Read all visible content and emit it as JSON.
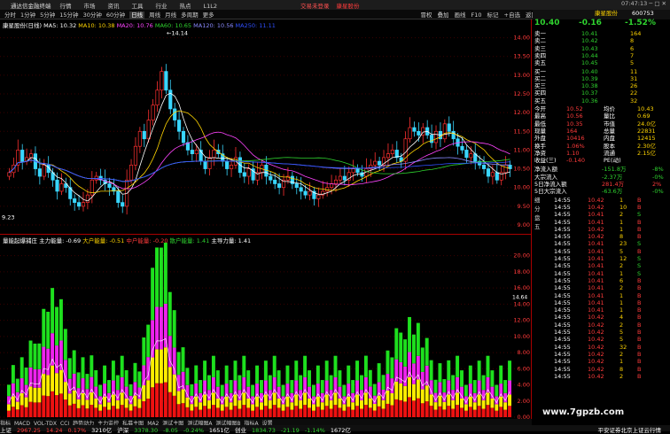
{
  "titlebar": {
    "app": "通达信金融终端",
    "menu": [
      "行情",
      "市场",
      "资讯",
      "工具",
      "行业",
      "热点",
      "L1L2"
    ],
    "notice1": "交易未登录",
    "notice2": "康星股份",
    "time": "07:47:13"
  },
  "toolbar": {
    "periods": [
      "分时",
      "1分钟",
      "5分钟",
      "15分钟",
      "30分钟",
      "60分钟",
      "日线",
      "周线",
      "月线",
      "多周期",
      "更多"
    ],
    "active_period": "日线",
    "right_tabs": [
      "冒权",
      "叠加",
      "画线",
      "F10",
      "标记",
      "+自选",
      "返回"
    ]
  },
  "kchart": {
    "legend": {
      "title": "康星股份(日线)",
      "ma5": "MA5: 10.32",
      "ma10": "MA10: 10.38",
      "ma20": "MA20: 10.76",
      "ma60": "MA60: 10.65",
      "ma120": "MA120: 10.56",
      "ma250": "MA250: 11.11"
    },
    "y_ticks": [
      "14.00",
      "13.50",
      "13.00",
      "12.50",
      "12.00",
      "11.50",
      "11.00",
      "10.50",
      "10.00",
      "9.50",
      "9.00"
    ],
    "high_label": "14.14",
    "low_label": "9.23",
    "ma_colors": {
      "ma5": "#ffffff",
      "ma10": "#ffd400",
      "ma20": "#ff44ff",
      "ma60": "#2fd32f",
      "ma120": "#8a8aff",
      "ma250": "#3050ff"
    }
  },
  "indicator": {
    "legend": {
      "title": "量能起爆捕庄",
      "main": "主力能量: -0.69",
      "big": "大户能量: -0.51",
      "mid": "中户能量: -0.20",
      "retail": "散户能量: 1.41",
      "force": "主导力量: 1.41"
    },
    "y_ticks": [
      "20.00",
      "18.00",
      "16.00",
      "14.00",
      "12.00",
      "10.00",
      "8.00",
      "6.00",
      "4.00",
      "2.00",
      "0.00"
    ],
    "side_label": "14.64",
    "series": [
      {
        "name": "散户能量",
        "color": "#1ee01e"
      },
      {
        "name": "中户能量",
        "color": "#ee22ee"
      },
      {
        "name": "大户能量",
        "color": "#ffee00"
      },
      {
        "name": "主力能量",
        "color": "#ee1111"
      }
    ]
  },
  "axis": {
    "year_label": "2023年",
    "month_label": "8",
    "date_label": "2023/10/13/五"
  },
  "tabs": [
    "指标",
    "MACD",
    "VOL-TDX",
    "CCI",
    "趋势动力",
    "主力监控",
    "私募主图",
    "MA2",
    "测试主图",
    "测试幅图A",
    "测试幅图B",
    "指标A",
    "设置"
  ],
  "subtabs": [
    "扩展区",
    "关联报价",
    "资金分布",
    "综合资讯",
    "行业资讯",
    "互动问答",
    "普及新功能说明"
  ],
  "quote": {
    "name": "康星股份",
    "code": "600753",
    "price": "10.40",
    "change": "-0.16",
    "pct": "-1.52%",
    "sells": [
      {
        "label": "卖五",
        "price": "10.45",
        "vol": "5"
      },
      {
        "label": "卖四",
        "price": "10.44",
        "vol": "7"
      },
      {
        "label": "卖三",
        "price": "10.43",
        "vol": "6"
      },
      {
        "label": "卖二",
        "price": "10.42",
        "vol": "8"
      },
      {
        "label": "卖一",
        "price": "10.41",
        "vol": "164"
      }
    ],
    "buys": [
      {
        "label": "买一",
        "price": "10.40",
        "vol": "11"
      },
      {
        "label": "买二",
        "price": "10.39",
        "vol": "31"
      },
      {
        "label": "买三",
        "price": "10.38",
        "vol": "26"
      },
      {
        "label": "买四",
        "price": "10.37",
        "vol": "22"
      },
      {
        "label": "买五",
        "price": "10.36",
        "vol": "32"
      }
    ],
    "stats": [
      [
        "今开",
        "10.52",
        "均价",
        "10.43"
      ],
      [
        "最高",
        "10.56",
        "量比",
        "0.69"
      ],
      [
        "最低",
        "10.35",
        "市值",
        "24.0亿"
      ],
      [
        "现量",
        "164",
        "总量",
        "22831"
      ],
      [
        "外盘",
        "10416",
        "内盘",
        "12415"
      ],
      [
        "换手",
        "1.06%",
        "股本",
        "2.30亿"
      ],
      [
        "净资",
        "1.10",
        "流通",
        "2.15亿"
      ],
      [
        "收益(三)",
        "-0.140",
        "PE(动)",
        ""
      ]
    ],
    "flows": [
      {
        "label": "净流入额",
        "value": "-151.8万",
        "pct": "-8%"
      },
      {
        "label": "大宗流入",
        "value": "-2.37万",
        "pct": "-0%"
      },
      {
        "label": "5日净流入额",
        "value": "281.4万",
        "pct": "2%"
      },
      {
        "label": "5日大宗流入",
        "value": "-63.6万",
        "pct": "-0%"
      }
    ],
    "ticks": [
      [
        "14:55",
        "10.42",
        "1",
        "B"
      ],
      [
        "14:55",
        "10.42",
        "10",
        "B"
      ],
      [
        "14:55",
        "10.41",
        "2",
        "S"
      ],
      [
        "14:55",
        "10.41",
        "1",
        "B"
      ],
      [
        "14:55",
        "10.42",
        "1",
        "B"
      ],
      [
        "14:55",
        "10.42",
        "8",
        "B"
      ],
      [
        "14:55",
        "10.41",
        "23",
        "S"
      ],
      [
        "14:55",
        "10.41",
        "5",
        "B"
      ],
      [
        "14:55",
        "10.41",
        "12",
        "S"
      ],
      [
        "14:55",
        "10.41",
        "2",
        "S"
      ],
      [
        "14:55",
        "10.41",
        "1",
        "S"
      ],
      [
        "14:55",
        "10.41",
        "6",
        "B"
      ],
      [
        "14:55",
        "10.41",
        "2",
        "B"
      ],
      [
        "14:55",
        "10.41",
        "1",
        "B"
      ],
      [
        "14:55",
        "10.41",
        "1",
        "B"
      ],
      [
        "14:55",
        "10.41",
        "1",
        "B"
      ],
      [
        "14:55",
        "10.42",
        "4",
        "B"
      ],
      [
        "14:55",
        "10.42",
        "2",
        "B"
      ],
      [
        "14:55",
        "10.42",
        "5",
        "B"
      ],
      [
        "14:55",
        "10.42",
        "5",
        "B"
      ],
      [
        "14:55",
        "10.42",
        "32",
        "B"
      ],
      [
        "14:55",
        "10.42",
        "2",
        "B"
      ],
      [
        "14:55",
        "10.42",
        "1",
        "B"
      ],
      [
        "14:55",
        "10.42",
        "8",
        "B"
      ],
      [
        "14:55",
        "10.42",
        "2",
        "B"
      ]
    ],
    "bottom_labels": [
      "细",
      "分",
      "盘",
      "五"
    ]
  },
  "status": [
    {
      "name": "上证",
      "value": "2967.25",
      "chg": "14.24",
      "pct": "0.17%",
      "amt": "3210亿"
    },
    {
      "name": "沪深",
      "value": "3378.30",
      "chg": "-8.05",
      "pct": "-0.24%",
      "amt": "1651亿"
    },
    {
      "name": "创业",
      "value": "1834.73",
      "chg": "-21.19",
      "pct": "-1.14%",
      "amt": "1672亿"
    }
  ],
  "status_right": "平安证券北京上证云行情",
  "watermark": "www.7gpzb.com"
}
